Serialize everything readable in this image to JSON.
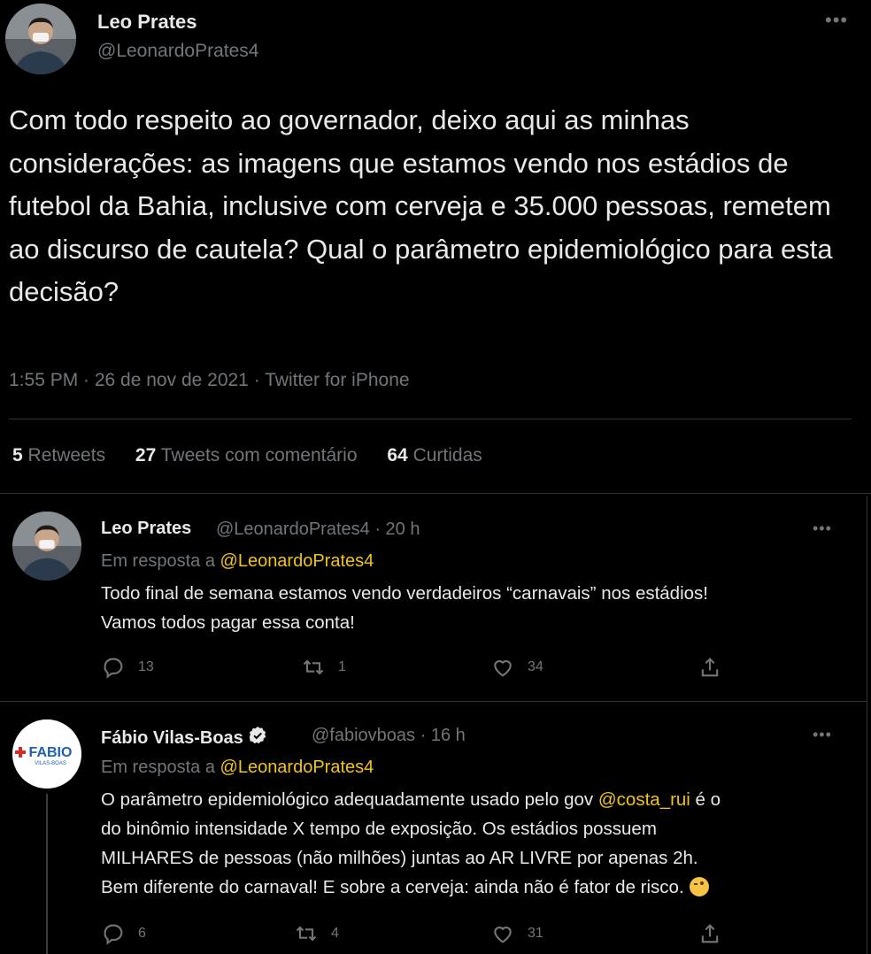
{
  "main_tweet": {
    "author_name": "Leo Prates",
    "author_handle": "@LeonardoPrates4",
    "more_label": "•••",
    "text": "Com todo respeito ao governador, deixo aqui as minhas considerações: as imagens que estamos vendo nos estádios de futebol da Bahia, inclusive com cerveja e 35.000 pessoas, remetem ao discurso de cautela? Qual o parâmetro epidemiológico para esta decisão?",
    "meta": "1:55 PM · 26 de nov de 2021 · Twitter for iPhone",
    "stats": {
      "retweets_count": "5",
      "retweets_label": "Retweets",
      "quotes_count": "27",
      "quotes_label": "Tweets com comentário",
      "likes_count": "64",
      "likes_label": "Curtidas"
    }
  },
  "replies": [
    {
      "author_name": "Leo Prates",
      "author_handle": "@LeonardoPrates4",
      "time": "· 20 h",
      "reply_prefix": "Em resposta a",
      "reply_to": "@LeonardoPrates4",
      "text_lines": [
        "Todo final de semana estamos vendo verdadeiros “carnavais” nos estádios!",
        "Vamos todos pagar essa conta!"
      ],
      "reply_count": "13",
      "retweet_count": "1",
      "like_count": "34",
      "more_label": "•••"
    },
    {
      "author_name": "Fábio Vilas-Boas",
      "author_handle": "@fabiovboas",
      "time": "· 16 h",
      "avatar_text": "FABIO",
      "avatar_subtext": "VILAS-BOAS",
      "reply_prefix": "Em resposta a",
      "reply_to": "@LeonardoPrates4",
      "text_line1_pre": "O parâmetro epidemiológico adequadamente usado pelo gov ",
      "text_line1_mention": "@costa_rui",
      "text_line1_post": " é o",
      "text_line2": "do binômio intensidade X tempo de exposição. Os estádios possuem",
      "text_line3": "MILHARES de pessoas (não milhões) juntas ao AR LIVRE por apenas 2h.",
      "text_line4": "Bem diferente do carnaval! E sobre a cerveja: ainda não é fator de risco.",
      "reply_count": "6",
      "retweet_count": "4",
      "like_count": "31",
      "more_label": "•••"
    }
  ],
  "colors": {
    "background": "#000000",
    "text": "#e7e9ea",
    "muted": "#71767b",
    "mention": "#f0c419",
    "divider": "#2f3336"
  }
}
